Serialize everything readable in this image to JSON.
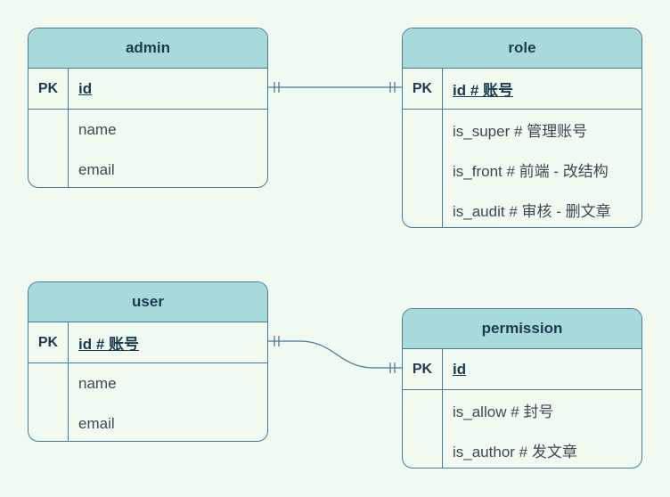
{
  "colors": {
    "background": "#f0faf0",
    "header": "#a8dadc",
    "border": "#4a7898",
    "text": "#1d3a4f"
  },
  "entities": {
    "admin": {
      "name": "admin",
      "pk_label": "PK",
      "pk_field": "id",
      "attributes": [
        "name",
        "email"
      ]
    },
    "role": {
      "name": "role",
      "pk_label": "PK",
      "pk_field": "id # 账号",
      "attributes": [
        "is_super # 管理账号",
        "is_front # 前端 - 改结构",
        "is_audit # 审核 - 删文章"
      ]
    },
    "user": {
      "name": "user",
      "pk_label": "PK",
      "pk_field": "id # 账号",
      "attributes": [
        "name",
        "email"
      ]
    },
    "permission": {
      "name": "permission",
      "pk_label": "PK",
      "pk_field": "id",
      "attributes": [
        "is_allow # 封号",
        "is_author # 发文章"
      ]
    }
  },
  "relationships": [
    {
      "from": "admin",
      "to": "role",
      "cardinality": "one-to-one"
    },
    {
      "from": "user",
      "to": "permission",
      "cardinality": "one-to-one"
    }
  ]
}
